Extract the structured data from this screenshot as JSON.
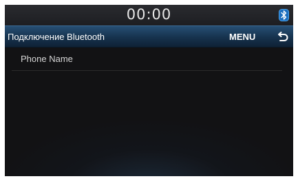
{
  "status_bar": {
    "time": "00:00",
    "bluetooth_icon": "bluetooth-icon"
  },
  "header": {
    "title": "Подключение Bluetooth",
    "menu_label": "MENU",
    "back_icon": "back-arrow-icon"
  },
  "list": {
    "items": [
      {
        "label": "Phone Name"
      }
    ]
  },
  "colors": {
    "header_blue": "#1f4466",
    "background": "#121214",
    "bluetooth_accent": "#2f8fe0"
  }
}
